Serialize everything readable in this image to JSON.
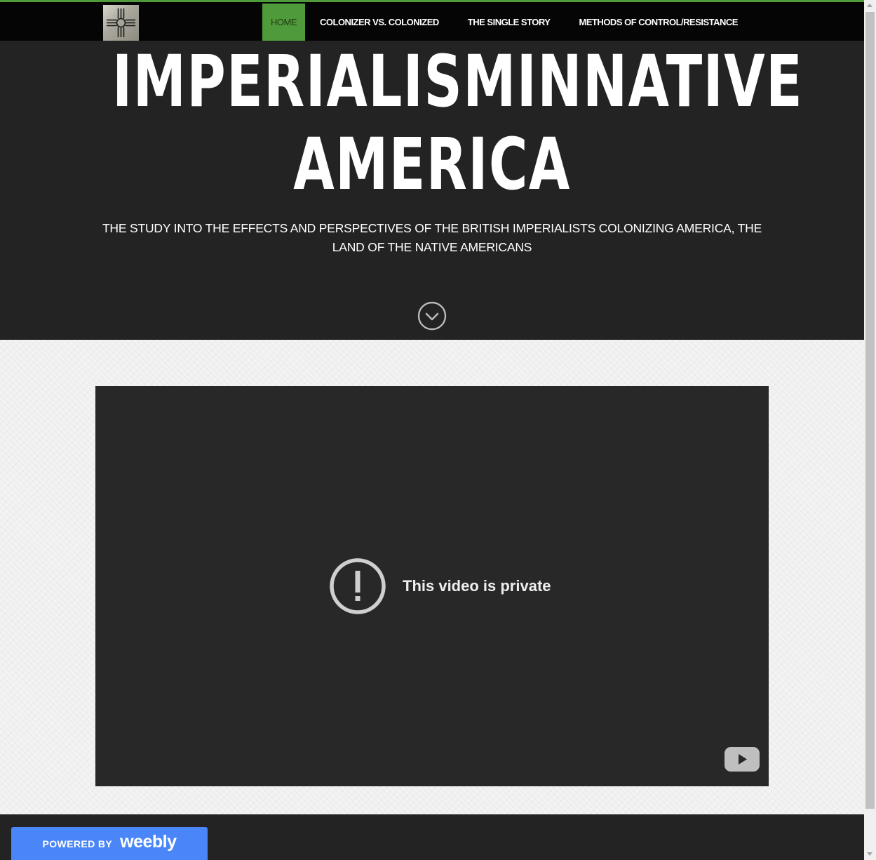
{
  "nav": {
    "logo_icon": "zia-sun-symbol-icon",
    "items": [
      {
        "label": "HOME",
        "active": true
      },
      {
        "label": "COLONIZER VS. COLONIZED",
        "active": false
      },
      {
        "label": "THE SINGLE STORY",
        "active": false
      },
      {
        "label": "METHODS OF CONTROL/RESISTANCE",
        "active": false
      }
    ]
  },
  "hero": {
    "title_line1": "IMPERIALISMINNATIVE",
    "title_line2": "AMERICA",
    "subtitle": "THE STUDY INTO THE EFFECTS AND PERSPECTIVES OF THE BRITISH IMPERIALISTS COLONIZING AMERICA, THE LAND OF THE NATIVE AMERICANS",
    "scroll_icon": "chevron-down-circle-icon"
  },
  "video": {
    "message": "This video is private",
    "status_icon": "exclamation-circle-icon",
    "brand_icon": "youtube-play-icon"
  },
  "footer": {
    "powered_by": "POWERED BY",
    "brand": "weebly"
  },
  "colors": {
    "accent": "#4f9a3a",
    "nav_bg": "#050505",
    "hero_bg": "#232323",
    "video_bg": "#282828",
    "weebly_blue": "#4a86f7"
  }
}
